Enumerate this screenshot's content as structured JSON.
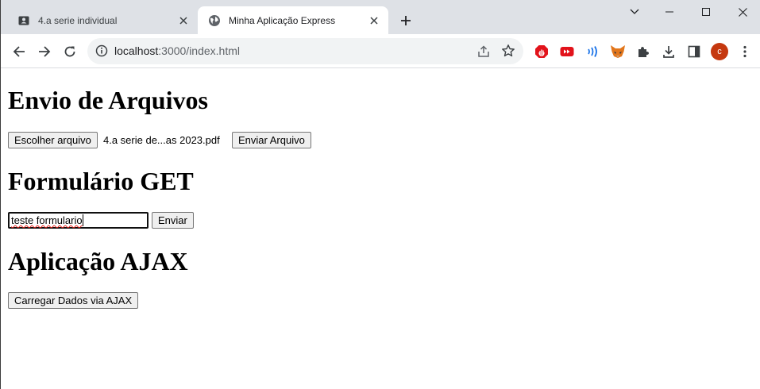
{
  "browser": {
    "tabs": [
      {
        "title": "4.a serie individual",
        "active": false,
        "icon": "contact-card-icon"
      },
      {
        "title": "Minha Aplicação Express",
        "active": true,
        "icon": "globe-icon"
      }
    ],
    "url_host": "localhost",
    "url_path": ":3000/index.html",
    "profile_initial": "c",
    "profile_color": "#c5380f",
    "extensions": [
      "adblock-icon",
      "youtube-icon",
      "wifi-signal-icon",
      "fox-icon",
      "puzzle-icon",
      "download-icon",
      "side-panel-icon"
    ]
  },
  "page": {
    "upload_section": {
      "heading": "Envio de Arquivos",
      "choose_file_label": "Escolher arquivo",
      "chosen_file_name": "4.a serie de...as 2023.pdf",
      "submit_label": "Enviar Arquivo"
    },
    "get_form_section": {
      "heading": "Formulário GET",
      "input_value": "teste formulario",
      "submit_label": "Enviar"
    },
    "ajax_section": {
      "heading": "Aplicação AJAX",
      "load_button_label": "Carregar Dados via AJAX"
    }
  }
}
